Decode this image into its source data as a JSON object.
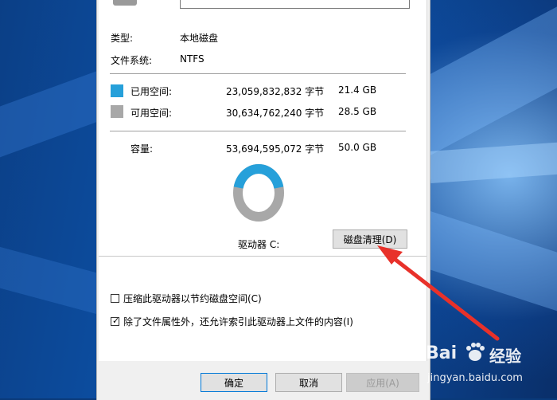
{
  "properties": {
    "type_label": "类型:",
    "type_value": "本地磁盘",
    "fs_label": "文件系统:",
    "fs_value": "NTFS",
    "used": {
      "label": "已用空间:",
      "bytes": "23,059,832,832 字节",
      "size": "21.4 GB",
      "color": "#26a0da"
    },
    "free": {
      "label": "可用空间:",
      "bytes": "30,634,762,240 字节",
      "size": "28.5 GB",
      "color": "#a8a8a8"
    },
    "capacity": {
      "label": "容量:",
      "bytes": "53,694,595,072 字节",
      "size": "50.0 GB"
    },
    "usage_fraction": 0.43,
    "drive_label": "驱动器 C:",
    "cleanup_button": "磁盘清理(D)"
  },
  "options": {
    "compress": {
      "label": "压缩此驱动器以节约磁盘空间(C)",
      "checked": false
    },
    "index": {
      "label": "除了文件属性外，还允许索引此驱动器上文件的内容(I)",
      "checked": true
    }
  },
  "footer": {
    "ok": "确定",
    "cancel": "取消",
    "apply": "应用(A)"
  },
  "watermark": {
    "brand_left": "Bai",
    "brand_right": "经验",
    "url": "jingyan.baidu.com"
  },
  "colors": {
    "accent": "#26a0da",
    "annotation_arrow": "#e8312a"
  }
}
